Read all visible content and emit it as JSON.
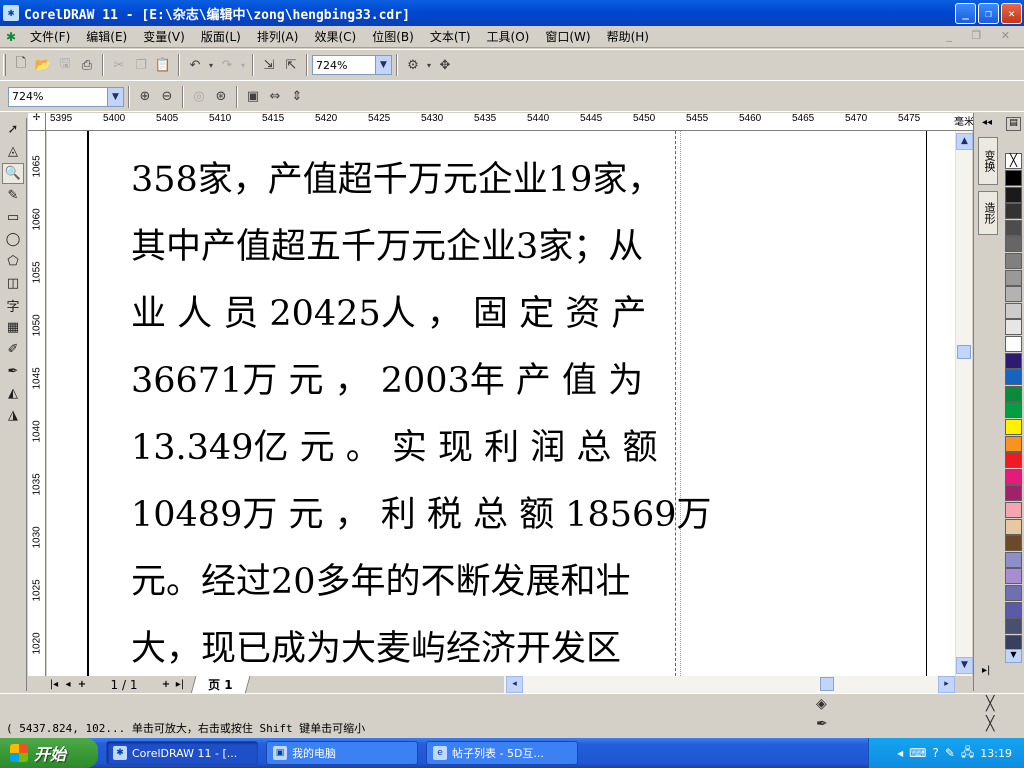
{
  "window": {
    "title": "CorelDRAW 11 - [E:\\杂志\\编辑中\\zong\\hengbing33.cdr]",
    "app_icon": "coreldraw-icon",
    "minimize_label": "_",
    "maximize_label": "❐",
    "close_label": "✕"
  },
  "menu": {
    "items": [
      "文件(F)",
      "编辑(E)",
      "变量(V)",
      "版面(L)",
      "排列(A)",
      "效果(C)",
      "位图(B)",
      "文本(T)",
      "工具(O)",
      "窗口(W)",
      "帮助(H)"
    ]
  },
  "toolbar": {
    "zoom_combo_value": "724%",
    "zoom_level_value": "724%"
  },
  "ruler": {
    "unit": "毫米",
    "h_ticks": [
      "5395",
      "5400",
      "5405",
      "5410",
      "5415",
      "5420",
      "5425",
      "5430",
      "5435",
      "5440",
      "5445",
      "5450",
      "5455",
      "5460",
      "5465",
      "5470",
      "5475"
    ],
    "v_ticks": [
      "1065",
      "1060",
      "1055",
      "1050",
      "1045",
      "1040",
      "1035",
      "1030",
      "1025",
      "1020"
    ],
    "v_unit": "毫米"
  },
  "document": {
    "lines": [
      "358家，产值超千万元企业19家，",
      "其中产值超五千万元企业3家；从",
      "业 人 员 20425人 ， 固 定 资 产",
      "36671万 元 ， 2003年 产 值 为",
      "13.349亿 元 。 实 现 利 润 总 额",
      "10489万 元 ， 利 税 总 额 18569万",
      "元。经过20多年的不断发展和壮",
      "大，现已成为大麦屿经济开发区"
    ]
  },
  "pager": {
    "page_count": "1 / 1",
    "page_tab": "页 1"
  },
  "docker": {
    "tabs": [
      "变换",
      "造形"
    ]
  },
  "palette": {
    "colors": [
      "#000000",
      "#1a1a1a",
      "#333333",
      "#4d4d4d",
      "#666666",
      "#808080",
      "#999999",
      "#b3b3b3",
      "#cccccc",
      "#e6e6e6",
      "#ffffff",
      "#2e1a6e",
      "#1565c0",
      "#0a8a3a",
      "#00a040",
      "#fff200",
      "#f7931e",
      "#ed1c24",
      "#e6197d",
      "#a0226b",
      "#f4a6b0",
      "#e8c8a0",
      "#6b4a2a",
      "#8e8ec8",
      "#a58fd0",
      "#7070b0",
      "#5a5aa8",
      "#485070",
      "#384060"
    ]
  },
  "status": {
    "text": "( 5437.824, 102...  单击可放大，右击或按住 Shift 键单击可缩小"
  },
  "taskbar": {
    "start_label": "开始",
    "tasks": [
      "CorelDRAW 11 - [...",
      "我的电脑",
      "帖子列表 - 5D互..."
    ],
    "clock": "13:19"
  }
}
